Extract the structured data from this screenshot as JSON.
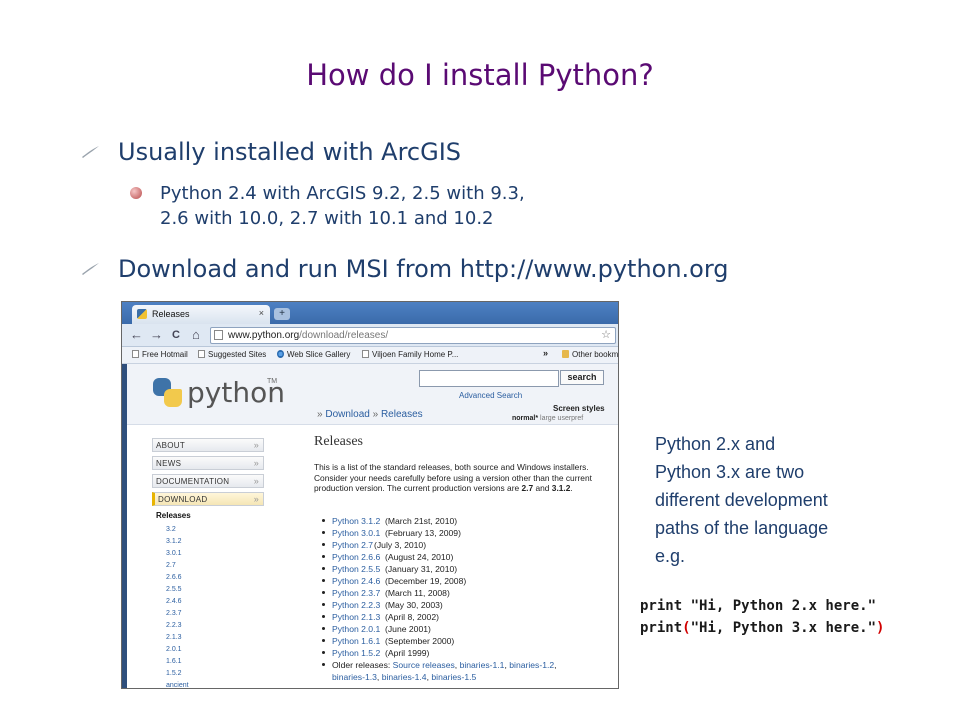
{
  "slide": {
    "title": "How do I install Python?",
    "bullets": [
      {
        "text": "Usually installed with ArcGIS"
      },
      {
        "text": "Download and run MSI from http://www.python.org"
      }
    ],
    "sub_bullet_lines": [
      "Python 2.4 with ArcGIS 9.2, 2.5 with 9.3,",
      "2.6 with 10.0, 2.7 with 10.1 and 10.2"
    ],
    "note_lines": [
      "Python 2.x and",
      "Python 3.x are two",
      "different development",
      "paths of the language",
      "e.g."
    ],
    "code": {
      "line1": "print \"Hi, Python 2.x here.\"",
      "line2_kw": "print",
      "line2_open": "(",
      "line2_str": "\"Hi, Python 3.x here.\"",
      "line2_close": ")"
    }
  },
  "browser": {
    "tab_label": "Releases",
    "tab_close": "×",
    "new_tab": "+",
    "nav": {
      "back": "←",
      "forward": "→",
      "reload": "C",
      "home": "⌂"
    },
    "url_host": "www.python.org",
    "url_path": "/download/releases/",
    "star": "☆",
    "bookmarks": [
      "Free Hotmail",
      "Suggested Sites",
      "Web Slice Gallery",
      "Viljoen Family Home P..."
    ],
    "bookmarks_more": "»",
    "other_bookmarks": "Other bookm",
    "site": {
      "logo_text": "python",
      "logo_tm": "TM",
      "search_button": "search",
      "search_value": "",
      "advanced_search": "Advanced Search",
      "crumb_prefix": "»",
      "crumb_download": "Download",
      "crumb_sep": "»",
      "crumb_releases": "Releases",
      "screen_styles": "Screen styles",
      "style_normal": "normal*",
      "style_large": "large",
      "style_userpref": "userpref",
      "nav": [
        "ABOUT",
        "NEWS",
        "DOCUMENTATION",
        "DOWNLOAD"
      ],
      "nav_arrow": "»",
      "nav_heading": "Releases",
      "nav_sub": [
        "3.2",
        "3.1.2",
        "3.0.1",
        "2.7",
        "2.6.6",
        "2.5.5",
        "2.4.6",
        "2.3.7",
        "2.2.3",
        "2.1.3",
        "2.0.1",
        "1.6.1",
        "1.5.2",
        "ancient"
      ],
      "heading": "Releases",
      "para_1": "This is a list of the standard releases, both source and Windows installers. Consider your needs carefully before using a version other than the current production version. The current production versions are ",
      "para_v1": "2.7",
      "para_and": " and ",
      "para_v2": "3.1.2",
      "para_end": ".",
      "releases": [
        {
          "name": "Python 3.1.2",
          "date": "(March 21st, 2010)"
        },
        {
          "name": "Python 3.0.1",
          "date": "(February 13, 2009)"
        },
        {
          "name": "Python 2.7",
          "date": "(July 3, 2010)"
        },
        {
          "name": "Python 2.6.6",
          "date": "(August 24, 2010)"
        },
        {
          "name": "Python 2.5.5",
          "date": "(January 31, 2010)"
        },
        {
          "name": "Python 2.4.6",
          "date": "(December 19, 2008)"
        },
        {
          "name": "Python 2.3.7",
          "date": "(March 11, 2008)"
        },
        {
          "name": "Python 2.2.3",
          "date": "(May 30, 2003)"
        },
        {
          "name": "Python 2.1.3",
          "date": "(April 8, 2002)"
        },
        {
          "name": "Python 2.0.1",
          "date": "(June 2001)"
        },
        {
          "name": "Python 1.6.1",
          "date": "(September 2000)"
        },
        {
          "name": "Python 1.5.2",
          "date": "(April 1999)"
        }
      ],
      "older_label": "Older releases: ",
      "older_links_1": [
        "Source releases",
        "binaries-1.1",
        "binaries-1.2"
      ],
      "older_links_2": [
        "binaries-1.3",
        "binaries-1.4",
        "binaries-1.5"
      ]
    }
  }
}
